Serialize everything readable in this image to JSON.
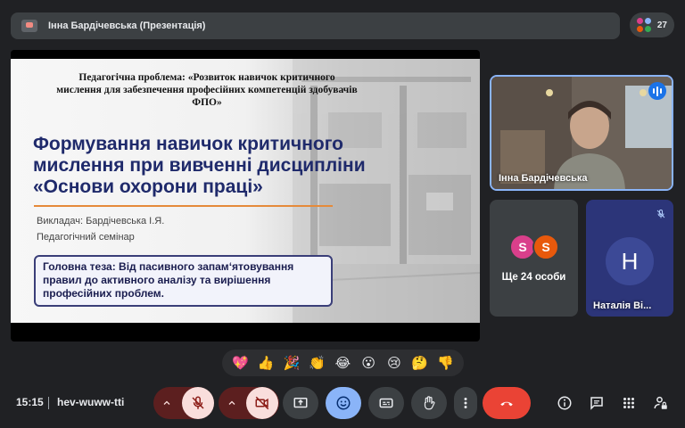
{
  "topbar": {
    "title": "Інна Бардічевська (Презентація)",
    "participant_count": "27"
  },
  "slide": {
    "problem": "Педагогічна проблема: «Розвиток навичок критичного мислення для забезпечення професійних компетенцій здобувачів ФПО»",
    "heading": "Формування навичок критичного мислення при вивченні дисципліни «Основи охорони праці»",
    "teacher": "Викладач: Бардічевська І.Я.",
    "seminar": "Педагогічний семінар",
    "thesis": "Головна теза: Від пасивного запам‘ятовування правил до активного аналізу та вирішення професійних проблем."
  },
  "participants": {
    "speaker_name": "Інна Бардічевська",
    "others_avatars": [
      {
        "letter": "S",
        "color": "#d93f8b"
      },
      {
        "letter": "S",
        "color": "#e8590c"
      }
    ],
    "others_label": "Ще 24 особи",
    "natalia_initial": "Н",
    "natalia_name": "Наталія Ві..."
  },
  "reactions": [
    "💖",
    "👍",
    "🎉",
    "👏",
    "😂",
    "😮",
    "😢",
    "🤔",
    "👎"
  ],
  "bottom": {
    "time": "15:15",
    "meeting_code": "hev-wuww-tti"
  },
  "colors": {
    "background": "#202124",
    "accent": "#8ab4f8",
    "end_call": "#ea4335",
    "muted_bg": "#f9dedc"
  },
  "icons": {
    "mic": "mic-off-icon",
    "camera": "camera-off-icon",
    "present": "present-screen-icon",
    "emoji": "emoji-icon",
    "captions": "captions-icon",
    "hand": "raise-hand-icon",
    "more": "more-vert-icon",
    "end": "end-call-icon",
    "info": "info-icon",
    "chat": "chat-icon",
    "activities": "apps-grid-icon",
    "host": "lock-person-icon"
  }
}
